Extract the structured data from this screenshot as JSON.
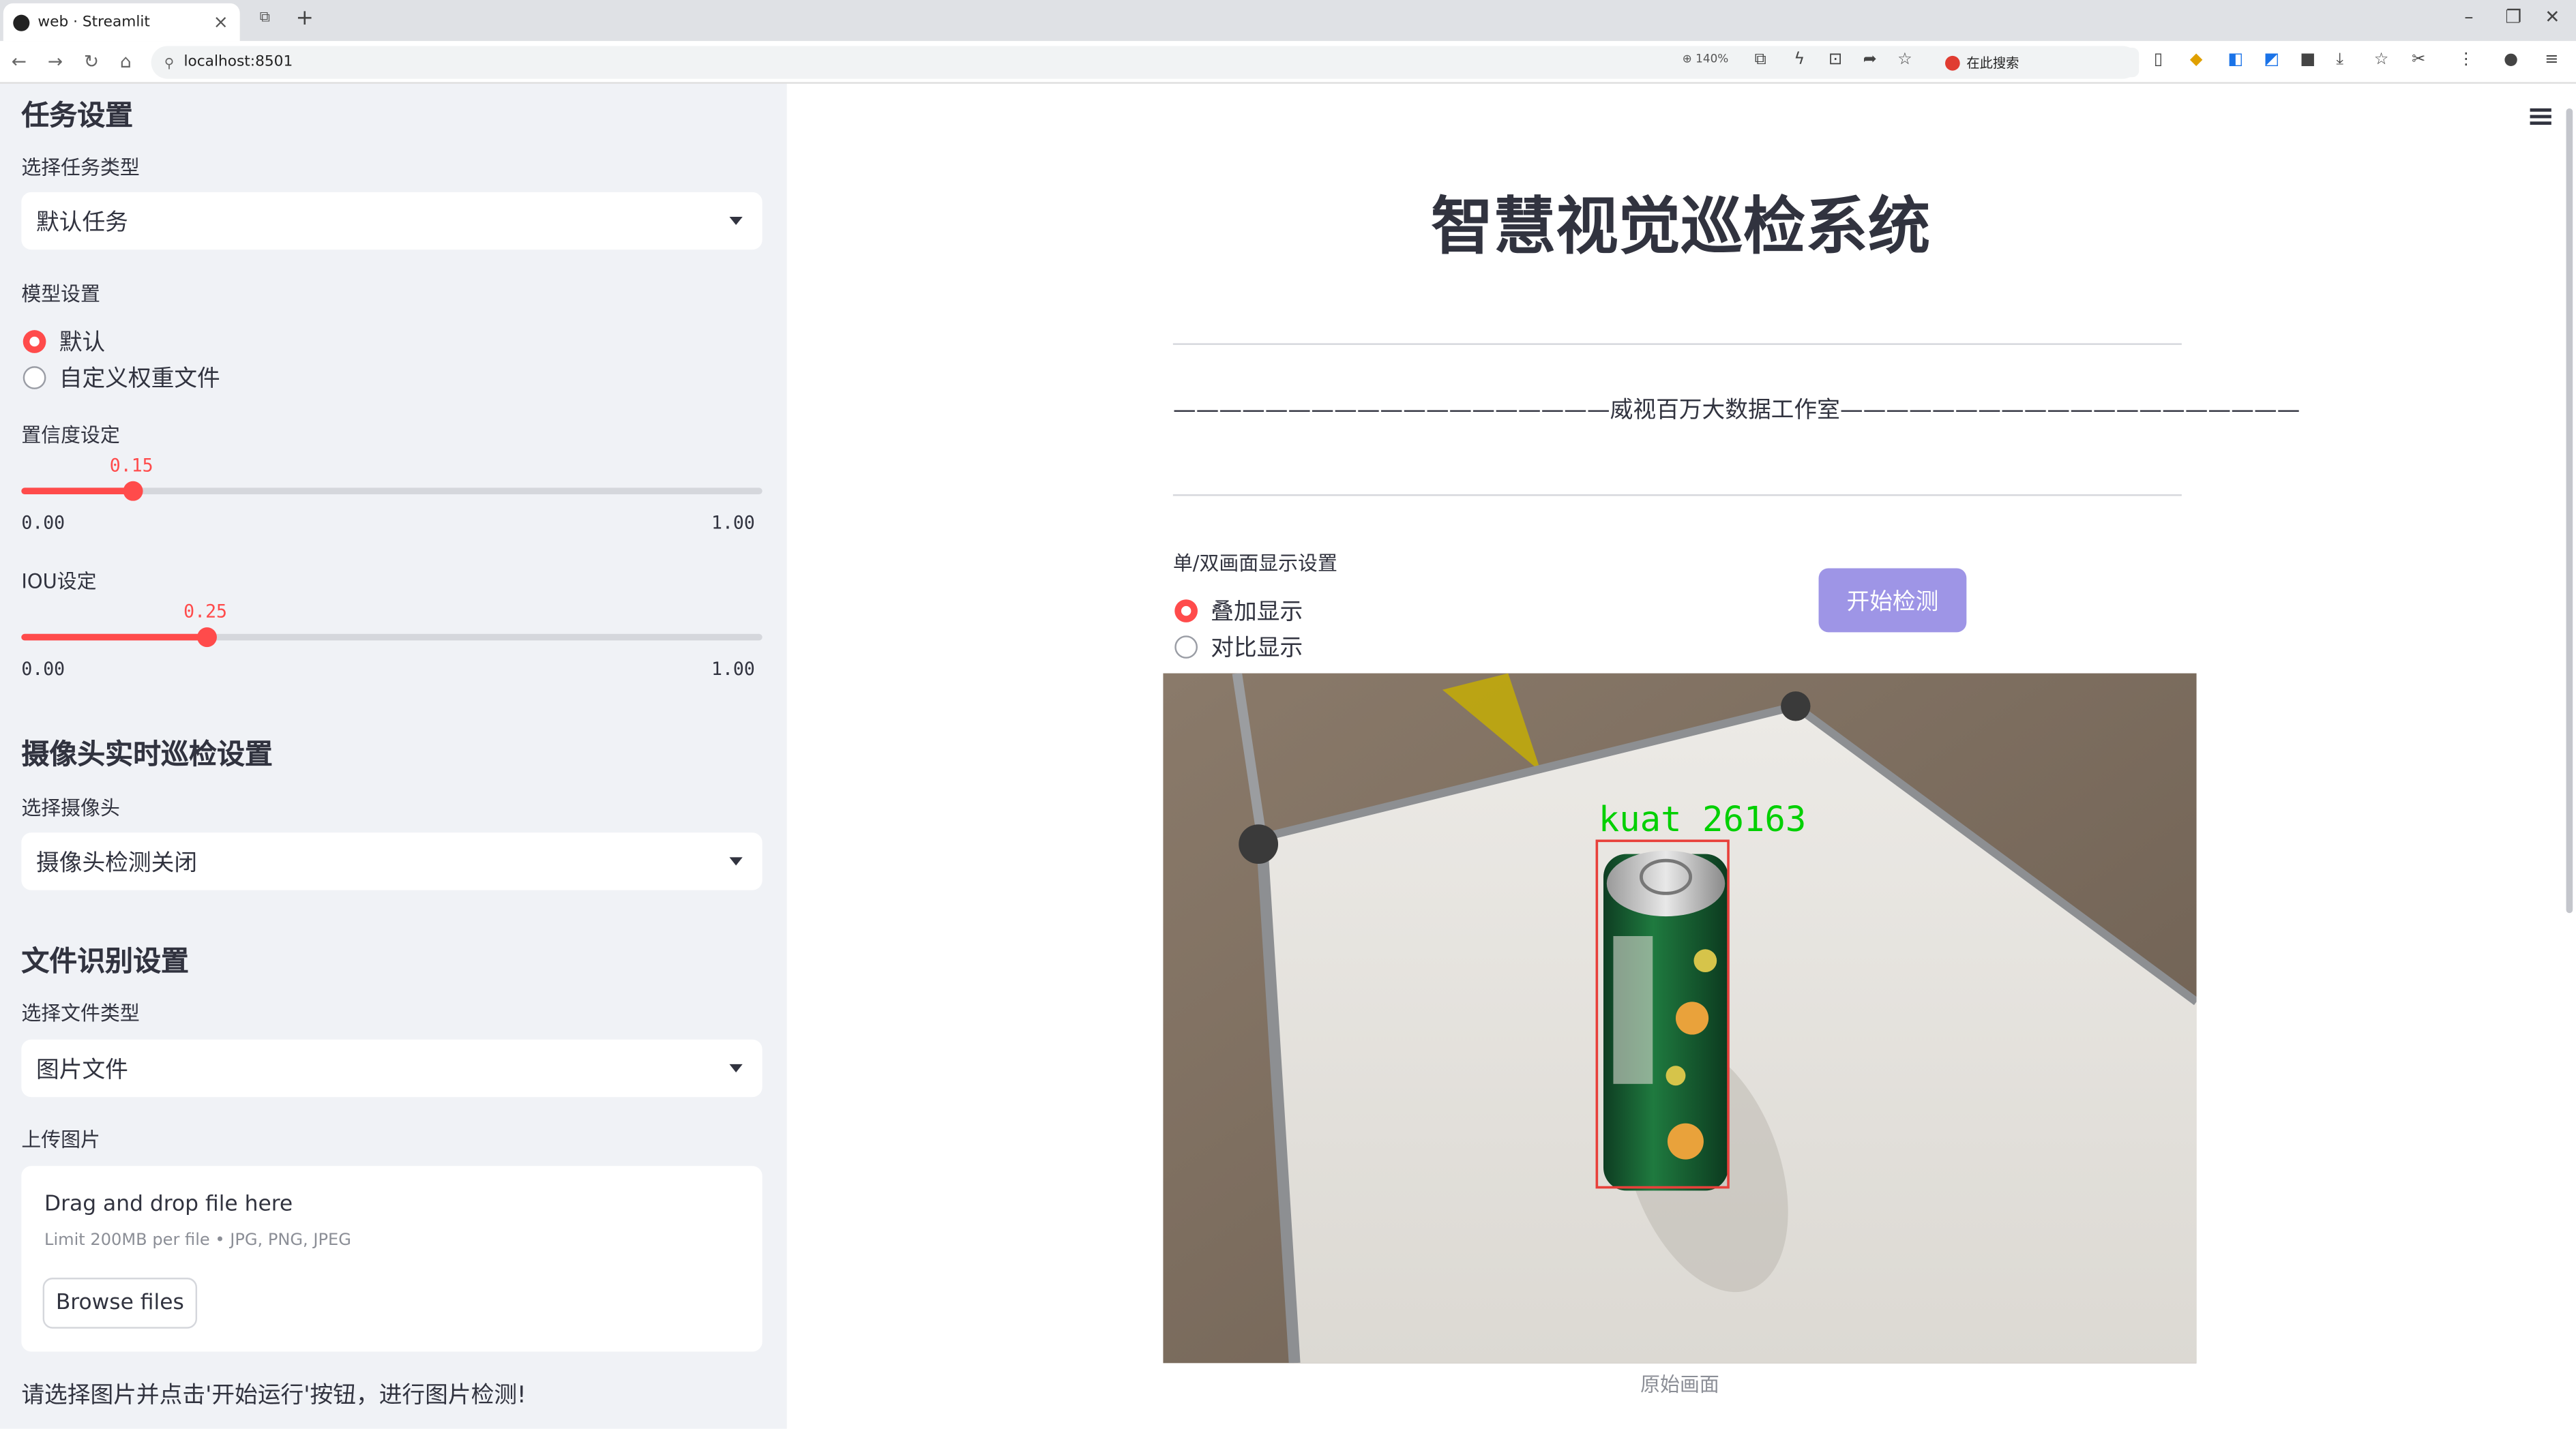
{
  "browser": {
    "tab_title": "web · Streamlit",
    "url": "localhost:8501",
    "zoom": "140%",
    "search_placeholder": "在此搜索"
  },
  "sidebar": {
    "task_heading": "任务设置",
    "task_type_label": "选择任务类型",
    "task_type_value": "默认任务",
    "model_label": "模型设置",
    "model_options": [
      "默认",
      "自定义权重文件"
    ],
    "model_selected": "默认",
    "confidence_label": "置信度设定",
    "confidence_value": "0.15",
    "confidence_fraction": 0.15,
    "confidence_min": "0.00",
    "confidence_max": "1.00",
    "iou_label": "IOU设定",
    "iou_value": "0.25",
    "iou_fraction": 0.25,
    "iou_min": "0.00",
    "iou_max": "1.00",
    "camera_heading": "摄像头实时巡检设置",
    "camera_label": "选择摄像头",
    "camera_value": "摄像头检测关闭",
    "file_heading": "文件识别设置",
    "file_type_label": "选择文件类型",
    "file_type_value": "图片文件",
    "upload_label": "上传图片",
    "upload_drag_text": "Drag and drop file here",
    "upload_limit_text": "Limit 200MB per file • JPG, PNG, JPEG",
    "browse_label": "Browse files",
    "hint_text": "请选择图片并点击'开始运行'按钮，进行图片检测!"
  },
  "main": {
    "title": "智慧视觉巡检系统",
    "banner": "———————————————————威视百万大数据工作室————————————————————",
    "display_label": "单/双画面显示设置",
    "display_options": [
      "叠加显示",
      "对比显示"
    ],
    "display_selected": "叠加显示",
    "start_button": "开始检测",
    "detection_label": "kuat 26163",
    "image_caption": "原始画面",
    "colors": {
      "accent": "#ff4b4b",
      "button": "#9e95e6",
      "detection_box": "#e8403a",
      "detection_text": "#00d000"
    }
  }
}
